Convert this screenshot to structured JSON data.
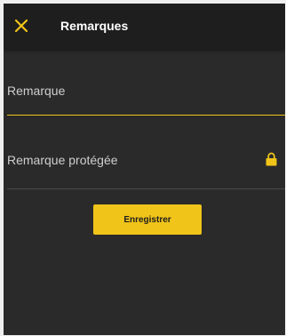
{
  "app_bar": {
    "title": "Remarques",
    "close_icon": "close-icon"
  },
  "form": {
    "remark_placeholder": "Remarque",
    "protected_remark_label": "Remarque protégée",
    "lock_icon": "lock-icon",
    "save_label": "Enregistrer"
  },
  "colors": {
    "accent": "#f0c419",
    "background": "#2a2a2a",
    "app_bar": "#1e1e1e",
    "text": "#cfcfcf"
  }
}
